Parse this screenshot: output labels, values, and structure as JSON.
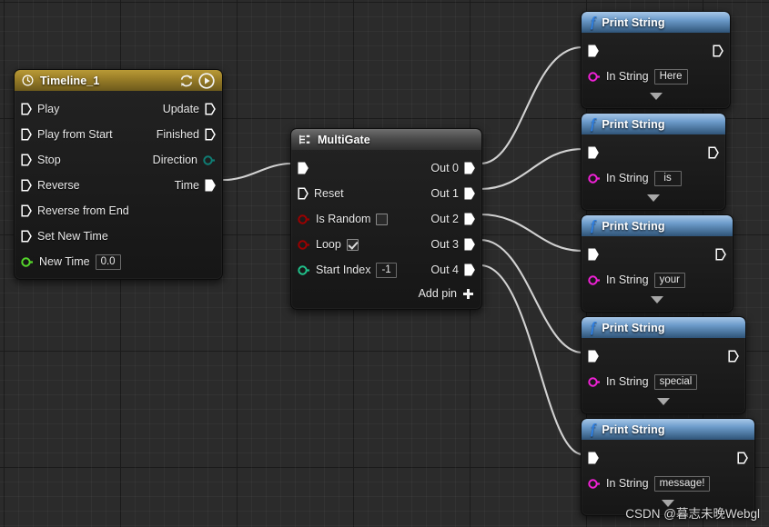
{
  "app": {
    "name": "Unreal Engine Blueprint Graph",
    "watermark": "CSDN @暮志未晚Webgl"
  },
  "nodes": {
    "timeline": {
      "title": "Timeline_1",
      "icon": "clock-icon",
      "header_buttons": [
        {
          "name": "loop-icon",
          "label": "loop"
        },
        {
          "name": "play-icon",
          "label": "play"
        }
      ],
      "inputs": [
        {
          "label": "Play",
          "type": "exec"
        },
        {
          "label": "Play from Start",
          "type": "exec"
        },
        {
          "label": "Stop",
          "type": "exec"
        },
        {
          "label": "Reverse",
          "type": "exec"
        },
        {
          "label": "Reverse from End",
          "type": "exec"
        },
        {
          "label": "Set New Time",
          "type": "exec"
        },
        {
          "label": "New Time",
          "type": "float",
          "value": "0.0"
        }
      ],
      "outputs": [
        {
          "label": "Update",
          "type": "exec"
        },
        {
          "label": "Finished",
          "type": "exec"
        },
        {
          "label": "Direction",
          "type": "enum"
        },
        {
          "label": "Time",
          "type": "exec-filled"
        }
      ]
    },
    "multigate": {
      "title": "MultiGate",
      "icon": "multigate-icon",
      "inputs": [
        {
          "label": "",
          "type": "exec-filled"
        },
        {
          "label": "Reset",
          "type": "exec"
        },
        {
          "label": "Is Random",
          "type": "bool",
          "checked": false
        },
        {
          "label": "Loop",
          "type": "bool",
          "checked": true
        },
        {
          "label": "Start Index",
          "type": "int",
          "value": "-1"
        }
      ],
      "outputs": [
        {
          "label": "Out 0",
          "type": "exec-filled"
        },
        {
          "label": "Out 1",
          "type": "exec-filled"
        },
        {
          "label": "Out 2",
          "type": "exec-filled"
        },
        {
          "label": "Out 3",
          "type": "exec-filled"
        },
        {
          "label": "Out 4",
          "type": "exec-filled"
        }
      ],
      "add_pin_label": "Add pin"
    },
    "print_strings": [
      {
        "title": "Print String",
        "in_string_label": "In String",
        "in_string_value": "Here"
      },
      {
        "title": "Print String",
        "in_string_label": "In String",
        "in_string_value": "is"
      },
      {
        "title": "Print String",
        "in_string_label": "In String",
        "in_string_value": "your"
      },
      {
        "title": "Print String",
        "in_string_label": "In String",
        "in_string_value": "special"
      },
      {
        "title": "Print String",
        "in_string_label": "In String",
        "in_string_value": "message!"
      }
    ]
  },
  "colors": {
    "canvas_bg": "#2b2b2b",
    "timeline_header": "#9a7e28",
    "multigate_header": "#4b4b4b",
    "print_header": "#6d9ccb",
    "exec_pin": "#ffffff",
    "float_pin": "#55d62b",
    "bool_pin": "#9c0000",
    "int_pin": "#20c08a",
    "string_pin": "#f021d6",
    "enum_pin": "#0f7d74",
    "wire": "#d2d2d2"
  }
}
